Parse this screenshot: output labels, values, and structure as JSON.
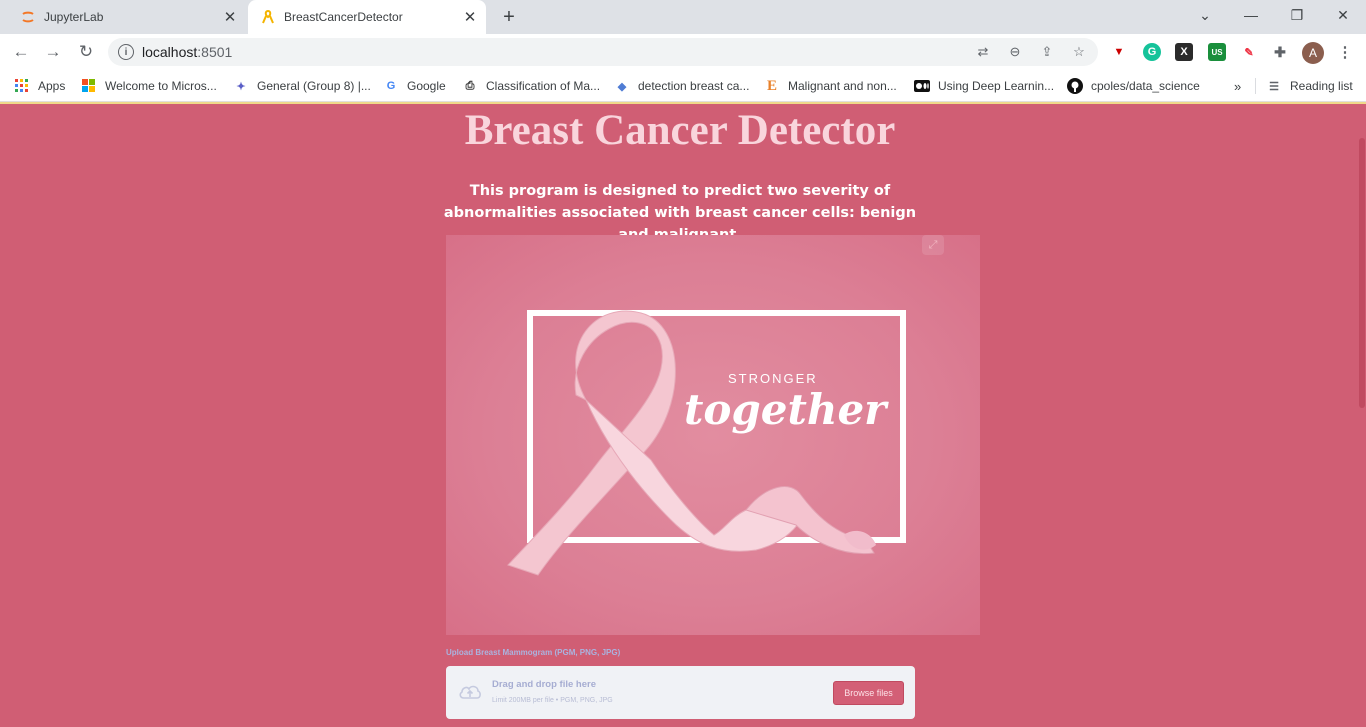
{
  "browser": {
    "tabs": [
      {
        "title": "JupyterLab",
        "icon": "jupyter-icon",
        "active": false
      },
      {
        "title": "BreastCancerDetector",
        "icon": "ribbon-icon",
        "active": true
      }
    ],
    "url_host": "localhost",
    "url_port": ":8501",
    "bookmarks": [
      {
        "label": "Apps",
        "icon": "apps-grid-icon"
      },
      {
        "label": "Welcome to Micros...",
        "icon": "microsoft-icon"
      },
      {
        "label": "General (Group 8) |...",
        "icon": "teams-icon"
      },
      {
        "label": "Google",
        "icon": "google-icon"
      },
      {
        "label": "Classification of Ma...",
        "icon": "document-icon"
      },
      {
        "label": "detection breast ca...",
        "icon": "cap-icon"
      },
      {
        "label": "Malignant and non...",
        "icon": "e-icon"
      },
      {
        "label": "Using Deep Learnin...",
        "icon": "medium-icon"
      },
      {
        "label": "cpoles/data_science",
        "icon": "github-icon"
      }
    ],
    "more_bookmarks": "»",
    "reading_list": "Reading list",
    "avatar_letter": "A",
    "ext_us_badge": "US"
  },
  "page": {
    "title": "Breast Cancer Detector",
    "description": "This program is designed to predict two severity of abnormalities associated with breast cancer cells: benign and malignant.",
    "image_text_top": "STRONGER",
    "image_text_main": "together",
    "upload_label": "Upload Breast Mammogram (PGM, PNG, JPG)",
    "dropzone_text": "Drag and drop file here",
    "dropzone_limit": "Limit 200MB per file • PGM, PNG, JPG",
    "browse_button": "Browse files"
  },
  "colors": {
    "background": "#d05e74",
    "title": "#f9d5dc",
    "button": "#d35f76"
  }
}
